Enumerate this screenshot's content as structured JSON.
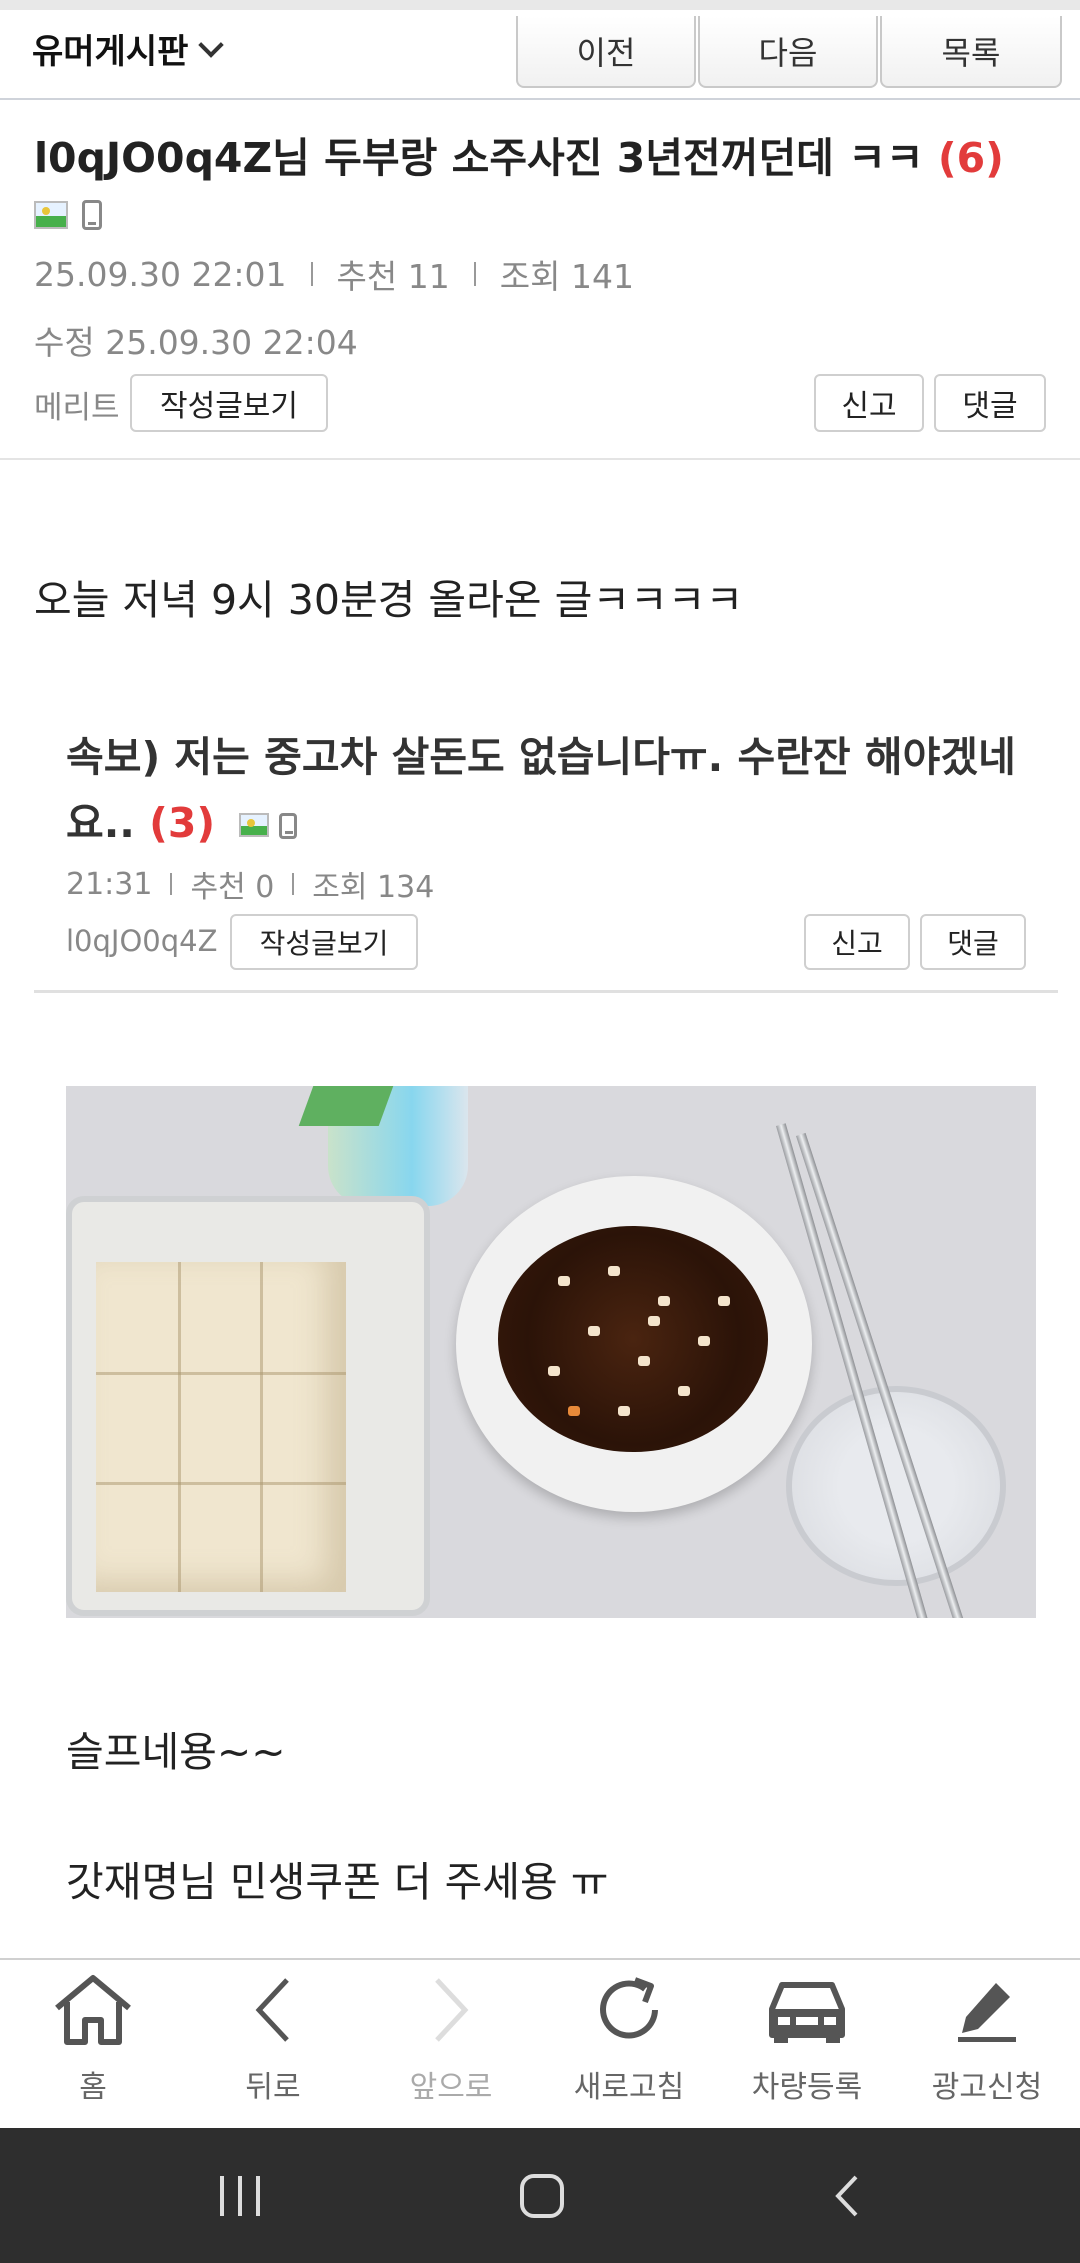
{
  "board": {
    "name": "유머게시판"
  },
  "nav": {
    "prev": "이전",
    "next": "다음",
    "list": "목록"
  },
  "post": {
    "title": "l0qJO0q4Z님 두부랑 소주사진 3년전꺼던데 ㅋㅋ",
    "comment_count": "(6)",
    "date": "25.09.30  22:01",
    "recommend": "추천 11",
    "views": "조회 141",
    "edited": "수정 25.09.30  22:04",
    "merit_label": "메리트",
    "view_posts": "작성글보기",
    "report": "신고",
    "comment": "댓글"
  },
  "body": {
    "intro": "오늘 저녁 9시 30분경 올라온 글ㅋㅋㅋㅋ",
    "quoted": {
      "title": "속보) 저는 중고차 살돈도 없습니다ㅠ. 수란잔 해야겠네요..",
      "comment_count": "(3)",
      "time": "21:31",
      "recommend": "추천 0",
      "views": "조회 134",
      "author": "l0qJO0q4Z",
      "view_posts": "작성글보기",
      "report": "신고",
      "comment": "댓글"
    },
    "line1": "슬프네용~~",
    "line2": "갓재명님  민생쿠폰 더 주세용 ㅠ"
  },
  "toolbar": {
    "home": "홈",
    "back": "뒤로",
    "forward": "앞으로",
    "refresh": "새로고침",
    "car": "차량등록",
    "ad": "광고신청"
  },
  "icons": {
    "home": "home-icon",
    "back": "chevron-left-icon",
    "forward": "chevron-right-icon",
    "refresh": "refresh-icon",
    "car": "car-icon",
    "ad": "pencil-icon",
    "sys_recent": "recent-apps-icon",
    "sys_home": "system-home-icon",
    "sys_back": "system-back-icon"
  },
  "colors": {
    "count_red": "#e23b3b",
    "meta_gray": "#888888",
    "sysbar": "#2e2e2e"
  }
}
